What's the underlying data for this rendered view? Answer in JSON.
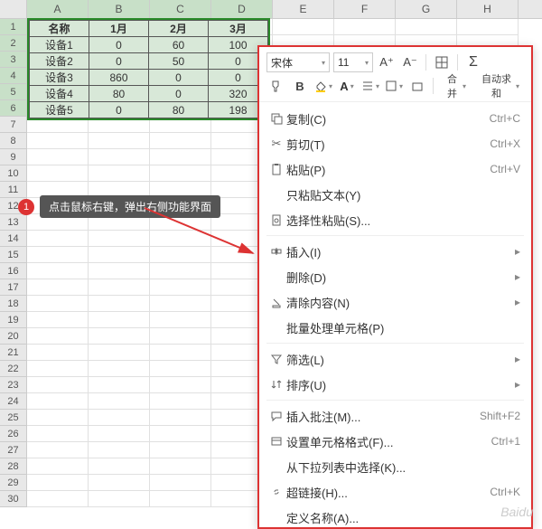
{
  "columns": [
    "A",
    "B",
    "C",
    "D",
    "E",
    "F",
    "G",
    "H"
  ],
  "row_count": 30,
  "selected_cols": 4,
  "selected_rows": 6,
  "table": {
    "headers": [
      "名称",
      "1月",
      "2月",
      "3月"
    ],
    "rows": [
      [
        "设备1",
        "0",
        "60",
        "100"
      ],
      [
        "设备2",
        "0",
        "50",
        "0"
      ],
      [
        "设备3",
        "860",
        "0",
        "0"
      ],
      [
        "设备4",
        "80",
        "0",
        "320"
      ],
      [
        "设备5",
        "0",
        "80",
        "198"
      ]
    ]
  },
  "callout": {
    "num": "1",
    "text": "点击鼠标右键，弹出右侧功能界面"
  },
  "toolbar": {
    "font": "宋体",
    "size": "11",
    "grow_label": "A⁺",
    "shrink_label": "A⁻",
    "merge_label": "合并",
    "autosum_label": "自动求和"
  },
  "menu": [
    {
      "icon": "copy",
      "label": "复制(C)",
      "shortcut": "Ctrl+C"
    },
    {
      "icon": "cut",
      "label": "剪切(T)",
      "shortcut": "Ctrl+X"
    },
    {
      "icon": "paste",
      "label": "粘贴(P)",
      "shortcut": "Ctrl+V"
    },
    {
      "icon": "",
      "label": "只粘贴文本(Y)",
      "shortcut": ""
    },
    {
      "icon": "paste-special",
      "label": "选择性粘贴(S)...",
      "shortcut": ""
    },
    {
      "sep": true
    },
    {
      "icon": "insert",
      "label": "插入(I)",
      "shortcut": "",
      "sub": true
    },
    {
      "icon": "",
      "label": "删除(D)",
      "shortcut": "",
      "sub": true
    },
    {
      "icon": "clear",
      "label": "清除内容(N)",
      "shortcut": "",
      "sub": true
    },
    {
      "icon": "",
      "label": "批量处理单元格(P)",
      "shortcut": ""
    },
    {
      "sep": true
    },
    {
      "icon": "filter",
      "label": "筛选(L)",
      "shortcut": "",
      "sub": true
    },
    {
      "icon": "sort",
      "label": "排序(U)",
      "shortcut": "",
      "sub": true
    },
    {
      "sep": true
    },
    {
      "icon": "comment",
      "label": "插入批注(M)...",
      "shortcut": "Shift+F2"
    },
    {
      "icon": "format",
      "label": "设置单元格格式(F)...",
      "shortcut": "Ctrl+1"
    },
    {
      "icon": "",
      "label": "从下拉列表中选择(K)...",
      "shortcut": ""
    },
    {
      "icon": "link",
      "label": "超链接(H)...",
      "shortcut": "Ctrl+K"
    },
    {
      "icon": "",
      "label": "定义名称(A)...",
      "shortcut": ""
    }
  ],
  "watermark": "Baidu"
}
